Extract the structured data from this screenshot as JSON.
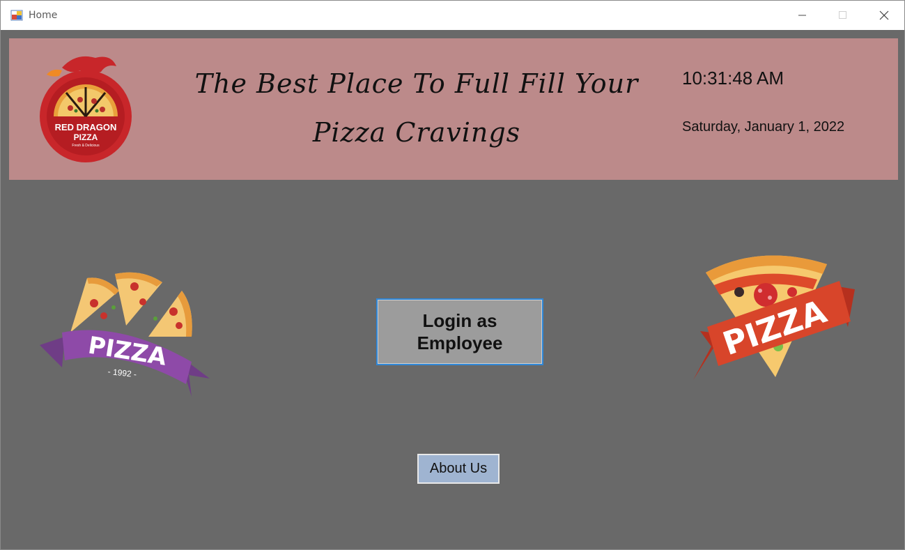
{
  "window": {
    "title": "Home",
    "icon": "app-window-icon"
  },
  "controls": {
    "minimize_icon": "minimize-icon",
    "maximize_icon": "maximize-icon",
    "close_icon": "close-icon"
  },
  "banner": {
    "headline_line1": "The Best Place To Full Fill Your",
    "headline_line2": "Pizza Cravings",
    "time": "10:31:48 AM",
    "date": "Saturday, January 1, 2022",
    "background_color": "#bc8a8a"
  },
  "logo": {
    "line1": "RED DRAGON",
    "line2": "PIZZA",
    "tagline": "Fresh & Delicious"
  },
  "badge_left": {
    "text": "PIZZA",
    "year": "- 1992 -"
  },
  "badge_right": {
    "text": "PIZZA"
  },
  "buttons": {
    "login_label": "Login as\nEmployee",
    "about_label": "About Us"
  },
  "colors": {
    "background": "#696969",
    "login_border": "#2f87d8",
    "about_background": "#9fb4d1"
  }
}
